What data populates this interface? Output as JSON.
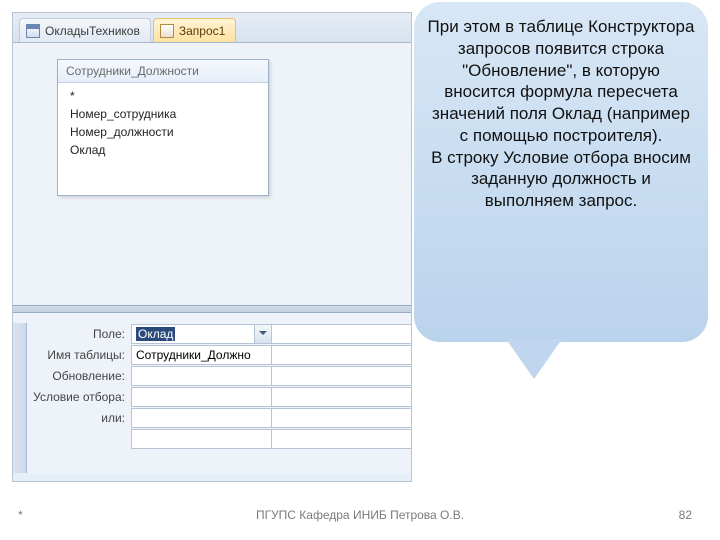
{
  "tabs": {
    "inactive": "ОкладыТехников",
    "active": "Запрос1"
  },
  "tablebox": {
    "title": "Сотрудники_Должности",
    "fields": [
      "*",
      "Номер_сотрудника",
      "Номер_должности",
      "Оклад"
    ]
  },
  "grid": {
    "labels": {
      "field": "Поле:",
      "table": "Имя таблицы:",
      "update": "Обновление:",
      "criteria": "Условие отбора:",
      "or": "или:"
    },
    "values": {
      "field": "Оклад",
      "table": "Сотрудники_Должно"
    }
  },
  "callout": {
    "text": "При этом в таблице Конструктора запросов появится строка \"Обновление\", в которую вносится формула пересчета значений поля Оклад (например с помощью построителя).\nВ строку Условие отбора вносим заданную должность и выполняем запрос."
  },
  "footer": {
    "star": "*",
    "center": "ПГУПС   Кафедра   ИНИБ   Петрова О.В.",
    "page": "82"
  }
}
